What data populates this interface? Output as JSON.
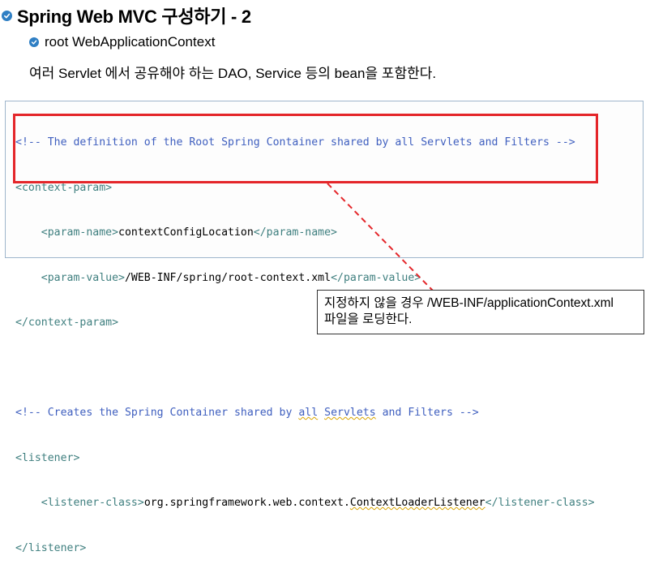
{
  "header": {
    "title": "Spring Web MVC 구성하기 - 2",
    "subtitle": "root WebApplicationContext",
    "description": "여러 Servlet 에서 공유해야 하는 DAO, Service 등의 bean을 포함한다."
  },
  "code": {
    "comment1": "<!-- The definition of the Root Spring Container shared by all Servlets and Filters -->",
    "open_context_param": "<context-param>",
    "param_name_open": "<param-name>",
    "param_name_value": "contextConfigLocation",
    "param_name_close": "</param-name>",
    "param_value_open": "<param-value>",
    "param_value_value": "/WEB-INF/spring/root-context.xml",
    "param_value_close": "</param-value>",
    "close_context_param": "</context-param>",
    "comment2_a": "<!-- Creates the Spring Container shared by ",
    "comment2_b": "all",
    "comment2_c": " ",
    "comment2_d": "Servlets",
    "comment2_e": " and Filters -->",
    "open_listener": "<listener>",
    "listener_class_open": "<listener-class>",
    "listener_class_value_a": "org.springframework.web.context.",
    "listener_class_value_b": "ContextLoaderListener",
    "listener_class_close": "</listener-class>",
    "close_listener": "</listener>"
  },
  "callout": {
    "line1": "지정하지 않을 경우 /WEB-INF/applicationContext.xml",
    "line2": "파일을 로딩한다."
  },
  "colors": {
    "accent": "#2f7fc4",
    "highlight": "#e4262a",
    "comment": "#3f5fbf",
    "tag": "#3f7f7f"
  }
}
